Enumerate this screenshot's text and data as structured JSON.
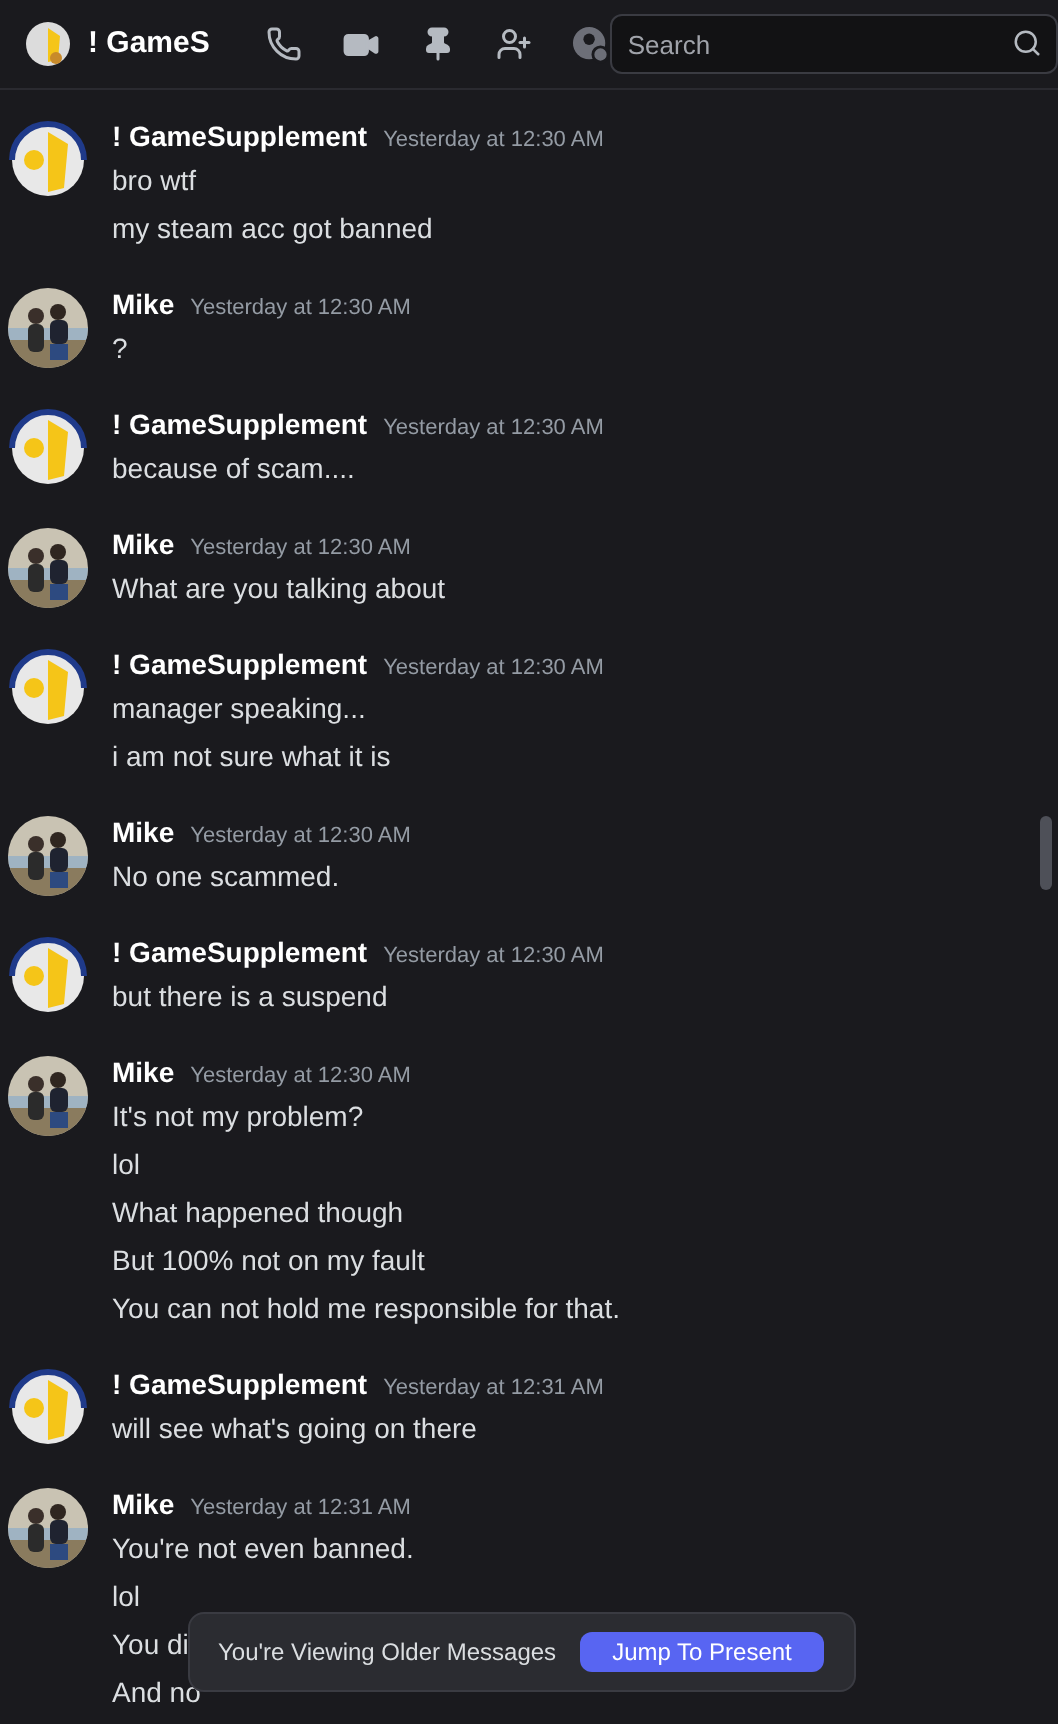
{
  "header": {
    "title": "! GameS",
    "search": {
      "placeholder": "Search"
    }
  },
  "messages": [
    {
      "author": "! GameSupplement",
      "kind": "logo",
      "time": "Yesterday at 12:30 AM",
      "lines": [
        "bro wtf",
        "my steam acc got banned"
      ]
    },
    {
      "author": "Mike",
      "kind": "picture",
      "time": "Yesterday at 12:30 AM",
      "lines": [
        "?"
      ]
    },
    {
      "author": "! GameSupplement",
      "kind": "logo",
      "time": "Yesterday at 12:30 AM",
      "lines": [
        "because of scam...."
      ]
    },
    {
      "author": "Mike",
      "kind": "picture",
      "time": "Yesterday at 12:30 AM",
      "lines": [
        "What are you talking about"
      ]
    },
    {
      "author": "! GameSupplement",
      "kind": "logo",
      "time": "Yesterday at 12:30 AM",
      "lines": [
        "manager speaking...",
        "i am not sure what it is"
      ]
    },
    {
      "author": "Mike",
      "kind": "picture",
      "time": "Yesterday at 12:30 AM",
      "lines": [
        "No one scammed."
      ]
    },
    {
      "author": "! GameSupplement",
      "kind": "logo",
      "time": "Yesterday at 12:30 AM",
      "lines": [
        "but there is a suspend"
      ]
    },
    {
      "author": "Mike",
      "kind": "picture",
      "time": "Yesterday at 12:30 AM",
      "lines": [
        "It's not my problem?",
        "lol",
        "What happened though",
        "But 100% not on my fault",
        "You can not hold me responsible for that."
      ]
    },
    {
      "author": "! GameSupplement",
      "kind": "logo",
      "time": "Yesterday at 12:31 AM",
      "lines": [
        "will see what's going on there"
      ]
    },
    {
      "author": "Mike",
      "kind": "picture",
      "time": "Yesterday at 12:31 AM",
      "lines": [
        "You're not even banned.",
        "lol",
        "You di",
        "And no"
      ]
    }
  ],
  "banner": {
    "text": "You're Viewing Older Messages",
    "button": "Jump To Present"
  }
}
